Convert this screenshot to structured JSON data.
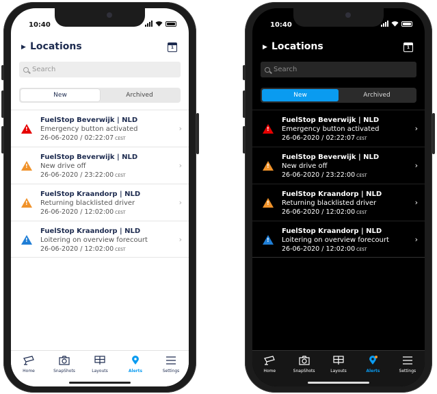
{
  "status": {
    "time": "10:40"
  },
  "header": {
    "title": "Locations",
    "calendar_day": "1"
  },
  "search": {
    "placeholder": "Search"
  },
  "segment": {
    "new": "New",
    "archived": "Archived"
  },
  "alerts": [
    {
      "title": "FuelStop Beverwijk | NLD",
      "description": "Emergency button activated",
      "timestamp": "26-06-2020 / 02:22:07",
      "tz": "CEST",
      "severity": "red"
    },
    {
      "title": "FuelStop Beverwijk | NLD",
      "description": "New drive off",
      "timestamp": "26-06-2020 / 23:22:00",
      "tz": "CEST",
      "severity": "orange"
    },
    {
      "title": "FuelStop Kraandorp | NLD",
      "description": "Returning blacklisted driver",
      "timestamp": "26-06-2020 / 12:02:00",
      "tz": "CEST",
      "severity": "orange"
    },
    {
      "title": "FuelStop Kraandorp | NLD",
      "description": "Loitering on overview forecourt",
      "timestamp": "26-06-2020 / 12:02:00",
      "tz": "CEST",
      "severity": "blue"
    }
  ],
  "tabs": {
    "home": "Home",
    "snapshots": "SnapShots",
    "layouts": "Layouts",
    "alerts": "Alerts",
    "settings": "Settings"
  },
  "colors": {
    "accent": "#0a9bf0",
    "alert_red": "#e60000",
    "alert_orange": "#f0922a",
    "alert_blue": "#1f7ed6"
  }
}
